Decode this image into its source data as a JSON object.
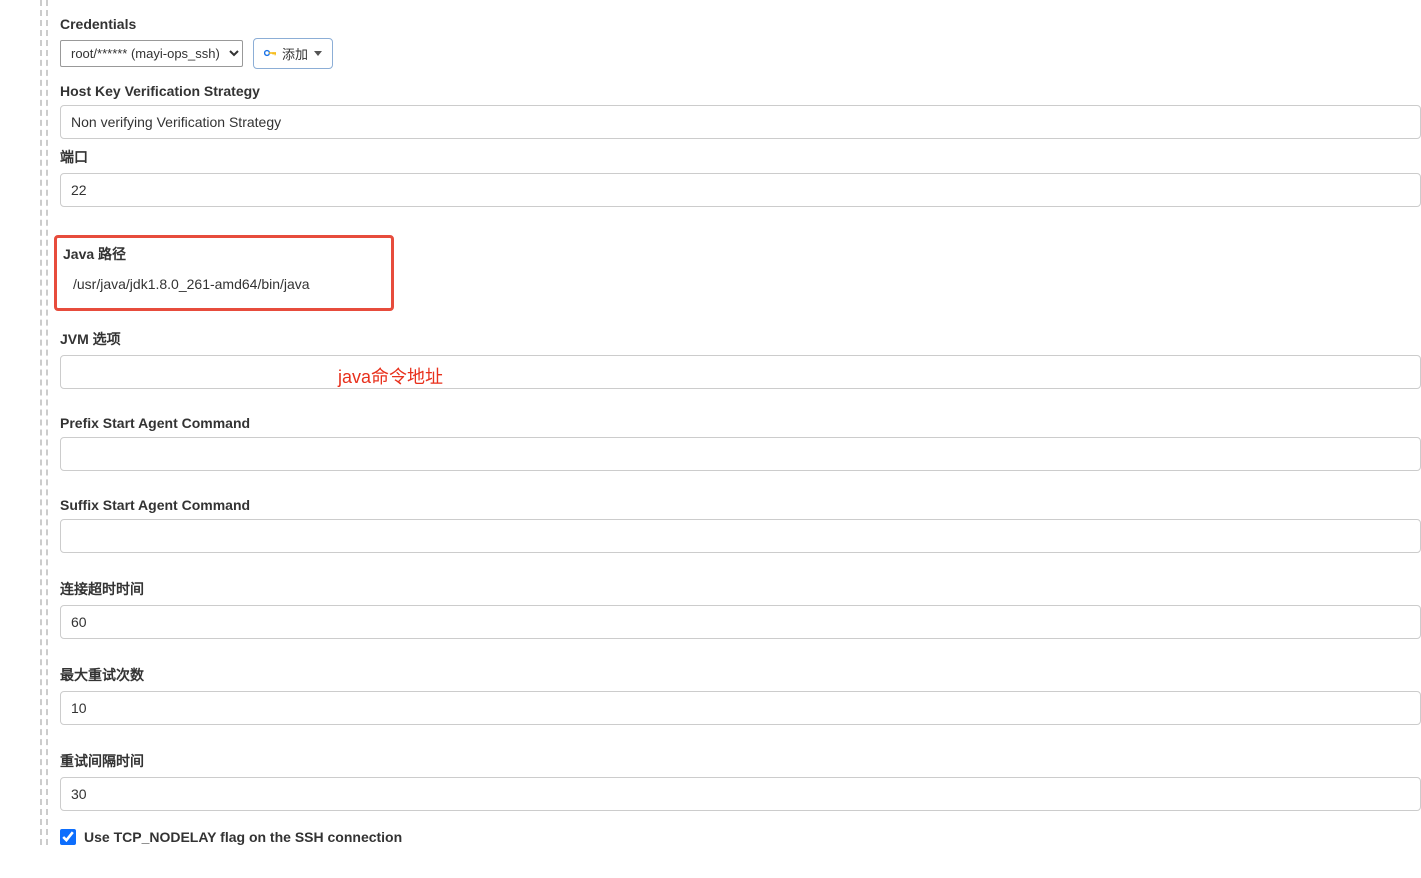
{
  "fields": {
    "credentials": {
      "label": "Credentials",
      "selected": "root/****** (mayi-ops_ssh)",
      "add_label": "添加"
    },
    "host_key": {
      "label": "Host Key Verification Strategy",
      "value": "Non verifying Verification Strategy"
    },
    "port": {
      "label": "端口",
      "value": "22"
    },
    "java_path": {
      "label": "Java 路径",
      "value": "/usr/java/jdk1.8.0_261-amd64/bin/java"
    },
    "jvm_options": {
      "label": "JVM 选项",
      "value": ""
    },
    "prefix_cmd": {
      "label": "Prefix Start Agent Command",
      "value": ""
    },
    "suffix_cmd": {
      "label": "Suffix Start Agent Command",
      "value": ""
    },
    "conn_timeout": {
      "label": "连接超时时间",
      "value": "60"
    },
    "max_retries": {
      "label": "最大重试次数",
      "value": "10"
    },
    "retry_interval": {
      "label": "重试间隔时间",
      "value": "30"
    },
    "tcp_nodelay": {
      "label": "Use TCP_NODELAY flag on the SSH connection",
      "checked": true
    }
  },
  "annotation": "java命令地址"
}
